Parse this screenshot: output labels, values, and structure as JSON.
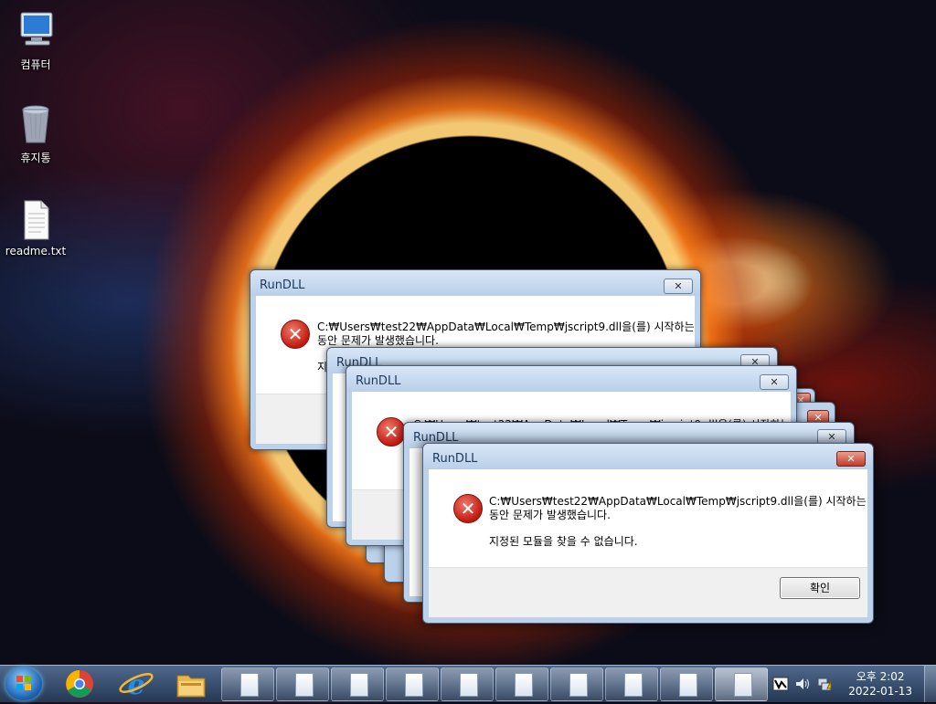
{
  "desktop": {
    "icons": [
      {
        "label": "컴퓨터",
        "icon": "computer-icon"
      },
      {
        "label": "휴지통",
        "icon": "recycle-bin-icon"
      },
      {
        "label": "readme.txt",
        "icon": "text-file-icon"
      }
    ]
  },
  "dialogs": [
    {
      "title": "RunDLL",
      "message_line1": "C:₩Users₩test22₩AppData₩Local₩Temp₩jscript9.dll을(를) 시작하는",
      "message_line2": "동안 문제가 발생했습니다.",
      "detail": "지",
      "close_glyph": "✕"
    },
    {
      "title": "RunDLL",
      "close_glyph": "✕"
    },
    {
      "title": "RunDLL",
      "message_line1": "C:₩Users₩test22₩AppData₩Local₩Temp₩jscript9.dll을(를) 시작하는",
      "close_glyph": "✕"
    },
    {
      "title": "RunDLL",
      "close_glyph": "✕"
    },
    {
      "title": "RunDLL",
      "message_line1": "C:₩Users₩test22₩AppData₩Local₩Temp₩jscript9.dll을(를) 시작하는",
      "message_line2": "동안 문제가 발생했습니다.",
      "detail": "지정된 모듈을 찾을 수 없습니다.",
      "ok_label": "확인",
      "close_glyph": "✕"
    }
  ],
  "error_glyph": "✕",
  "taskbar": {
    "pinned": [
      "chrome-icon",
      "internet-explorer-icon",
      "file-explorer-icon"
    ],
    "window_buttons": 10,
    "tray_icons": [
      "flag-icon",
      "volume-icon",
      "network-icon"
    ],
    "time": "오후 2:02",
    "date": "2022-01-13"
  }
}
